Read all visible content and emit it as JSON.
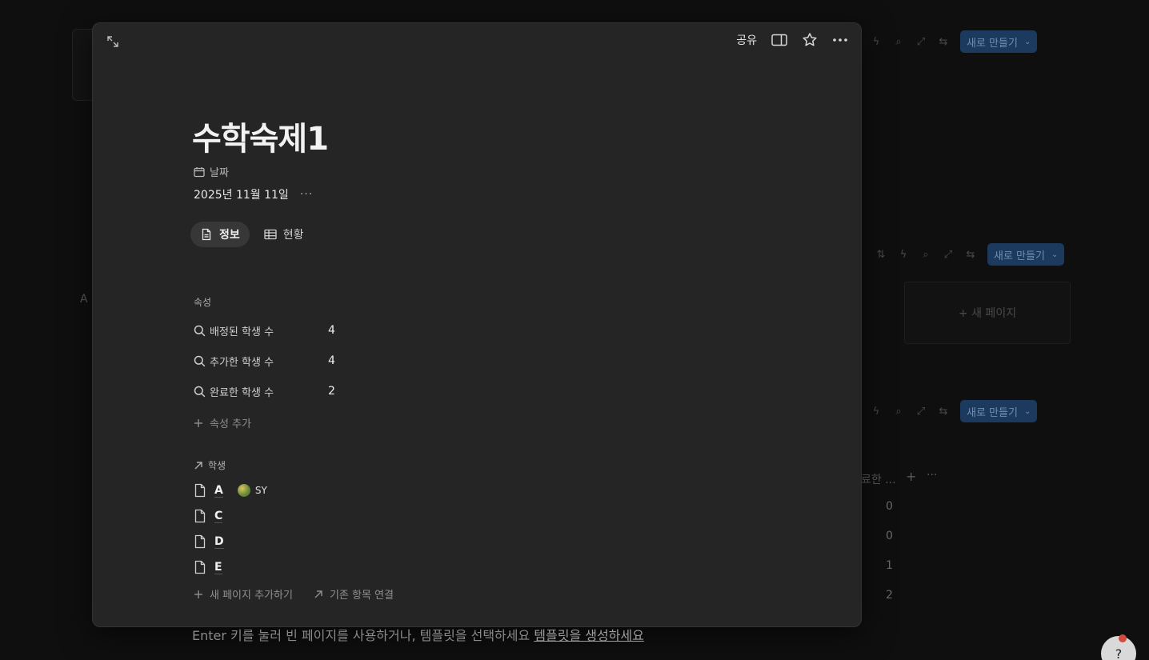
{
  "background": {
    "toolbars": [
      {
        "new_label": "새로 만들기"
      },
      {
        "new_label": "새로 만들기"
      },
      {
        "new_label": "새로 만들기"
      }
    ],
    "panel_new_page": "+ 새 페이지",
    "letter_a": "A",
    "cut_header": "료한 ...",
    "numbers": [
      "0",
      "0",
      "1",
      "2"
    ]
  },
  "modal": {
    "share_label": "공유",
    "title": "수학숙제1",
    "date": {
      "label": "날짜",
      "value": "2025년 11월 11일",
      "more": "···"
    },
    "tabs": [
      {
        "label": "정보",
        "icon": "document-icon",
        "active": true
      },
      {
        "label": "현황",
        "icon": "table-icon",
        "active": false
      }
    ],
    "properties_section": "속성",
    "properties": [
      {
        "label": "배정된 학생 수",
        "value": "4"
      },
      {
        "label": "추가한 학생 수",
        "value": "4"
      },
      {
        "label": "완료한 학생 수",
        "value": "2"
      }
    ],
    "add_property": "속성 추가",
    "relation": {
      "label": "학생",
      "items": [
        {
          "name": "A",
          "chip": "SY"
        },
        {
          "name": "C",
          "chip": ""
        },
        {
          "name": "D",
          "chip": ""
        },
        {
          "name": "E",
          "chip": ""
        }
      ],
      "add_new_page": "새 페이지 추가하기",
      "link_existing": "기존 항목 연결"
    },
    "hint": {
      "text": "Enter 키를 눌러 빈 페이지를 사용하거나, 템플릿을 선택하세요 ",
      "link": "템플릿을 생성하세요"
    }
  }
}
